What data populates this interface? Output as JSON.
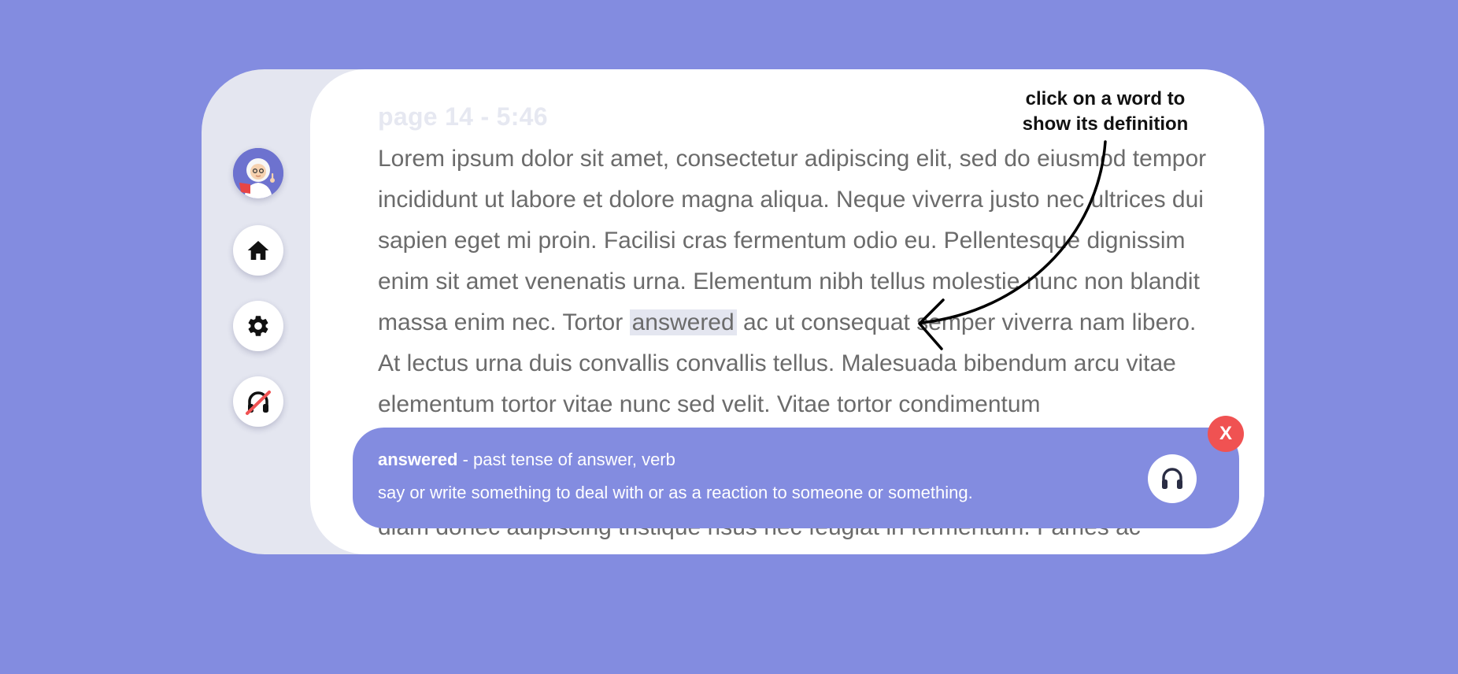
{
  "reader": {
    "page_label": "page 14 - 5:46",
    "text_before": "Lorem ipsum dolor sit amet, consectetur adipiscing elit, sed do eiusmod tempor incididunt ut labore et dolore magna aliqua. Neque viverra justo nec ultrices dui sapien eget mi proin. Facilisi cras fermentum odio eu. Pellentesque dignissim enim sit amet venenatis urna. Elementum nibh tellus molestie nunc non blandit massa enim nec. Tortor",
    "highlighted_word": "answered",
    "text_after": "ac ut consequat semper viverra nam libero. At lectus urna duis convallis convallis tellus. Malesuada bibendum arcu vitae elementum tortor vitae nunc sed velit. Vitae tortor condimentum",
    "text_hidden_line": "diam donec adipiscing tristique risus nec feugiat in fermentum. Fames ac"
  },
  "definition": {
    "word": "answered",
    "grammar": " - past tense of answer, verb",
    "meaning": "say or write something to deal with or as a reaction to someone or something.",
    "audio_icon": "headphones-icon",
    "close_label": "X"
  },
  "hint": {
    "line1": "click on a word to",
    "line2": "show its definition"
  },
  "sidebar": {
    "items": [
      {
        "name": "avatar",
        "icon": "professor-avatar"
      },
      {
        "name": "home",
        "icon": "home-icon"
      },
      {
        "name": "settings",
        "icon": "gear-icon"
      },
      {
        "name": "audio-off",
        "icon": "headphones-off-icon"
      }
    ]
  },
  "colors": {
    "background": "#838ce0",
    "panel": "#e4e6f0",
    "close": "#f05252",
    "text": "#6b6b6b"
  }
}
